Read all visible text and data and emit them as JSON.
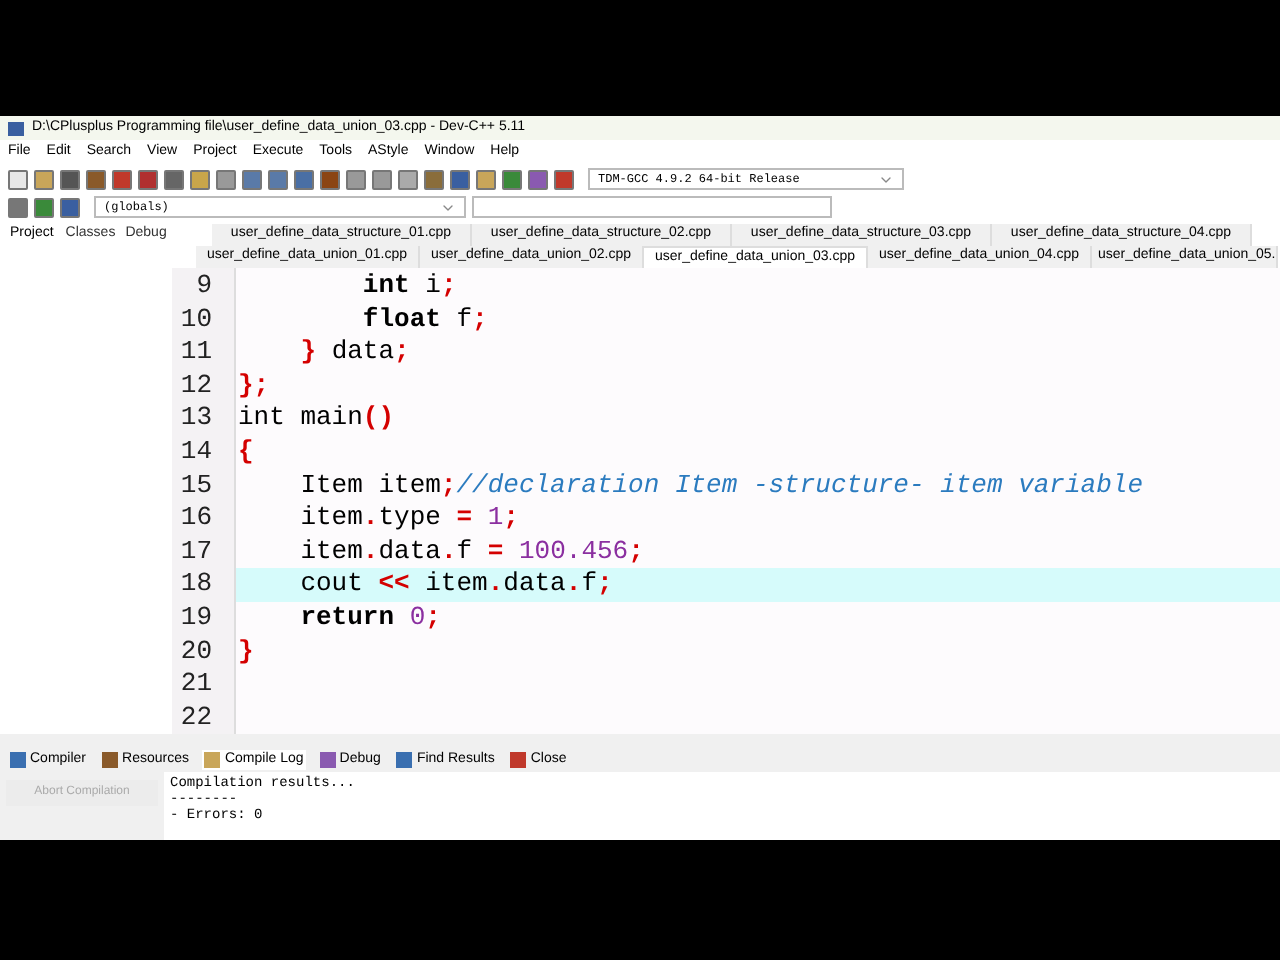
{
  "window": {
    "title": "D:\\CPlusplus Programming file\\user_define_data_union_03.cpp - Dev-C++ 5.11"
  },
  "menu": [
    "File",
    "Edit",
    "Search",
    "View",
    "Project",
    "Execute",
    "Tools",
    "AStyle",
    "Window",
    "Help"
  ],
  "compiler_select": {
    "value": "TDM-GCC 4.9.2 64-bit Release"
  },
  "scope_select": {
    "value": "(globals)"
  },
  "side_tabs": [
    {
      "label": "Project",
      "selected": true
    },
    {
      "label": "Classes",
      "selected": false
    },
    {
      "label": "Debug",
      "selected": false
    }
  ],
  "file_tabs_row_1": [
    {
      "label": "user_define_data_structure_01.cpp",
      "selected": false
    },
    {
      "label": "user_define_data_structure_02.cpp",
      "selected": false
    },
    {
      "label": "user_define_data_structure_03.cpp",
      "selected": false
    },
    {
      "label": "user_define_data_structure_04.cpp",
      "selected": false
    }
  ],
  "file_tabs_row_2": [
    {
      "label": "user_define_data_union_01.cpp",
      "selected": false
    },
    {
      "label": "user_define_data_union_02.cpp",
      "selected": false
    },
    {
      "label": "user_define_data_union_03.cpp",
      "selected": true
    },
    {
      "label": "user_define_data_union_04.cpp",
      "selected": false
    },
    {
      "label": "user_define_data_union_05.",
      "selected": false
    }
  ],
  "code_lines": [
    {
      "number": "9",
      "current": false,
      "tokens": [
        {
          "kind": "keyword",
          "text": "        int"
        },
        {
          "kind": "plain",
          "text": " i"
        },
        {
          "kind": "punct",
          "text": ";"
        }
      ]
    },
    {
      "number": "10",
      "current": false,
      "tokens": [
        {
          "kind": "keyword",
          "text": "        float"
        },
        {
          "kind": "plain",
          "text": " f"
        },
        {
          "kind": "punct",
          "text": ";"
        }
      ]
    },
    {
      "number": "11",
      "current": false,
      "tokens": [
        {
          "kind": "punct",
          "text": "    }"
        },
        {
          "kind": "plain",
          "text": " data"
        },
        {
          "kind": "punct",
          "text": ";"
        }
      ]
    },
    {
      "number": "12",
      "current": false,
      "tokens": [
        {
          "kind": "punct",
          "text": "};"
        }
      ]
    },
    {
      "number": "13",
      "current": false,
      "tokens": [
        {
          "kind": "plain",
          "text": "int main"
        },
        {
          "kind": "punct",
          "text": "()"
        }
      ]
    },
    {
      "number": "14",
      "current": false,
      "tokens": [
        {
          "kind": "punct",
          "text": "{"
        }
      ]
    },
    {
      "number": "15",
      "current": false,
      "tokens": [
        {
          "kind": "plain",
          "text": "    Item item"
        },
        {
          "kind": "punct",
          "text": ";"
        },
        {
          "kind": "comment",
          "text": "//declaration Item -structure- item variable"
        }
      ]
    },
    {
      "number": "16",
      "current": false,
      "tokens": [
        {
          "kind": "plain",
          "text": "    item"
        },
        {
          "kind": "punct",
          "text": "."
        },
        {
          "kind": "plain",
          "text": "type "
        },
        {
          "kind": "punct",
          "text": "= "
        },
        {
          "kind": "number",
          "text": "1"
        },
        {
          "kind": "punct",
          "text": ";"
        }
      ]
    },
    {
      "number": "17",
      "current": false,
      "tokens": [
        {
          "kind": "plain",
          "text": "    item"
        },
        {
          "kind": "punct",
          "text": "."
        },
        {
          "kind": "plain",
          "text": "data"
        },
        {
          "kind": "punct",
          "text": "."
        },
        {
          "kind": "plain",
          "text": "f "
        },
        {
          "kind": "punct",
          "text": "= "
        },
        {
          "kind": "number",
          "text": "100.456"
        },
        {
          "kind": "punct",
          "text": ";"
        }
      ]
    },
    {
      "number": "18",
      "current": true,
      "tokens": [
        {
          "kind": "plain",
          "text": "    cout "
        },
        {
          "kind": "punct",
          "text": "<<"
        },
        {
          "kind": "plain",
          "text": " item"
        },
        {
          "kind": "punct",
          "text": "."
        },
        {
          "kind": "plain",
          "text": "data"
        },
        {
          "kind": "punct",
          "text": "."
        },
        {
          "kind": "plain",
          "text": "f"
        },
        {
          "kind": "punct",
          "text": ";"
        }
      ]
    },
    {
      "number": "19",
      "current": false,
      "tokens": [
        {
          "kind": "keyword",
          "text": "    return "
        },
        {
          "kind": "number",
          "text": "0"
        },
        {
          "kind": "punct",
          "text": ";"
        }
      ]
    },
    {
      "number": "20",
      "current": false,
      "tokens": [
        {
          "kind": "punct",
          "text": "}"
        }
      ]
    },
    {
      "number": "21",
      "current": false
    },
    {
      "number": "22",
      "current": false
    }
  ],
  "bottom_tabs": [
    {
      "label": "Compiler",
      "selected": false
    },
    {
      "label": "Resources",
      "selected": false
    },
    {
      "label": "Compile Log",
      "selected": true
    },
    {
      "label": "Debug",
      "selected": false
    },
    {
      "label": "Find Results",
      "selected": false
    },
    {
      "label": "Close",
      "selected": false
    }
  ],
  "abort_button": {
    "label": "Abort Compilation",
    "disabled": true
  },
  "log_lines": [
    "Compilation results...",
    "--------",
    "- Errors: 0"
  ]
}
